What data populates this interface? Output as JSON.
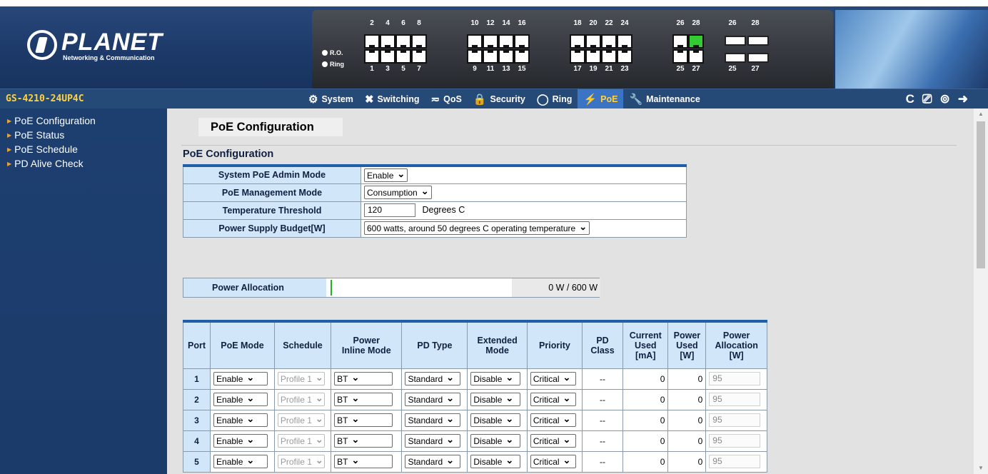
{
  "brand": {
    "logo_text": "PLANET",
    "logo_sub": "Networking & Communication"
  },
  "panel": {
    "legend": [
      "R.O.",
      "Ring"
    ],
    "top_numbers": [
      "2",
      "4",
      "6",
      "8",
      "10",
      "12",
      "14",
      "16",
      "18",
      "20",
      "22",
      "24",
      "26",
      "28",
      "26",
      "28"
    ],
    "bottom_numbers": [
      "1",
      "3",
      "5",
      "7",
      "9",
      "11",
      "13",
      "15",
      "17",
      "19",
      "21",
      "23",
      "25",
      "27",
      "25",
      "27"
    ],
    "active_port": "28"
  },
  "navbar": {
    "model": "GS-4210-24UP4C",
    "menu": [
      {
        "label": "System",
        "icon": "gear-icon",
        "glyph": "⚙"
      },
      {
        "label": "Switching",
        "icon": "switching-icon",
        "glyph": "✖"
      },
      {
        "label": "QoS",
        "icon": "qos-icon",
        "glyph": "≂"
      },
      {
        "label": "Security",
        "icon": "lock-icon",
        "glyph": "🔒"
      },
      {
        "label": "Ring",
        "icon": "ring-icon",
        "glyph": "◯"
      },
      {
        "label": "PoE",
        "icon": "poe-icon",
        "glyph": "⚡"
      },
      {
        "label": "Maintenance",
        "icon": "wrench-icon",
        "glyph": "🔧"
      }
    ],
    "active_menu": "PoE",
    "toolbar": [
      {
        "name": "refresh-icon",
        "glyph": "C"
      },
      {
        "name": "save-icon",
        "glyph": "⎚"
      },
      {
        "name": "reboot-icon",
        "glyph": "⊚"
      },
      {
        "name": "logout-icon",
        "glyph": "➜"
      }
    ]
  },
  "sidebar": {
    "items": [
      "PoE Configuration",
      "PoE Status",
      "PoE Schedule",
      "PD Alive Check"
    ]
  },
  "main": {
    "page_title": "PoE Configuration",
    "section_title": "PoE Configuration",
    "config": {
      "admin_mode_label": "System PoE Admin Mode",
      "admin_mode_value": "Enable",
      "mgmt_mode_label": "PoE Management Mode",
      "mgmt_mode_value": "Consumption",
      "temp_label": "Temperature Threshold",
      "temp_value": "120",
      "temp_unit": "Degrees C",
      "budget_label": "Power Supply Budget[W]",
      "budget_value": "600 watts, around 50 degrees C operating temperature"
    },
    "allocation": {
      "label": "Power Allocation",
      "value": "0 W / 600 W",
      "used_fraction": 0
    },
    "port_table": {
      "headers": [
        "Port",
        "PoE Mode",
        "Schedule",
        "Power\nInline Mode",
        "PD Type",
        "Extended\nMode",
        "Priority",
        "PD\nClass",
        "Current\nUsed\n[mA]",
        "Power\nUsed\n[W]",
        "Power\nAllocation\n[W]"
      ],
      "rows": [
        {
          "port": "1",
          "poe_mode": "Enable",
          "schedule": "Profile 1",
          "inline_mode": "BT",
          "pd_type": "Standard",
          "extended": "Disable",
          "priority": "Critical",
          "pd_class": "--",
          "current": "0",
          "power": "0",
          "allocation": "95"
        },
        {
          "port": "2",
          "poe_mode": "Enable",
          "schedule": "Profile 1",
          "inline_mode": "BT",
          "pd_type": "Standard",
          "extended": "Disable",
          "priority": "Critical",
          "pd_class": "--",
          "current": "0",
          "power": "0",
          "allocation": "95"
        },
        {
          "port": "3",
          "poe_mode": "Enable",
          "schedule": "Profile 1",
          "inline_mode": "BT",
          "pd_type": "Standard",
          "extended": "Disable",
          "priority": "Critical",
          "pd_class": "--",
          "current": "0",
          "power": "0",
          "allocation": "95"
        },
        {
          "port": "4",
          "poe_mode": "Enable",
          "schedule": "Profile 1",
          "inline_mode": "BT",
          "pd_type": "Standard",
          "extended": "Disable",
          "priority": "Critical",
          "pd_class": "--",
          "current": "0",
          "power": "0",
          "allocation": "95"
        },
        {
          "port": "5",
          "poe_mode": "Enable",
          "schedule": "Profile 1",
          "inline_mode": "BT",
          "pd_type": "Standard",
          "extended": "Disable",
          "priority": "Critical",
          "pd_class": "--",
          "current": "0",
          "power": "0",
          "allocation": "95"
        }
      ]
    }
  },
  "colors": {
    "header_bg": "#1d3a6a",
    "nav_bg": "#264a78",
    "accent": "#1f5ea8",
    "label_bg": "#d2e6fa",
    "model_text": "#ffd23f"
  }
}
